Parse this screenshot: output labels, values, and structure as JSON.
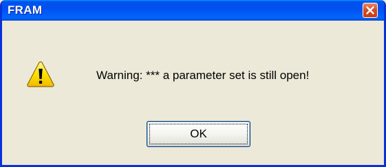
{
  "window": {
    "title": "FRAM"
  },
  "dialog": {
    "icon": "warning-icon",
    "message": "Warning: *** a parameter set is still open!",
    "ok_label": "OK"
  },
  "colors": {
    "titlebar": "#0053ee",
    "close_button": "#d64d24",
    "dialog_background": "#ece9d8",
    "warning_yellow": "#ffd800"
  }
}
